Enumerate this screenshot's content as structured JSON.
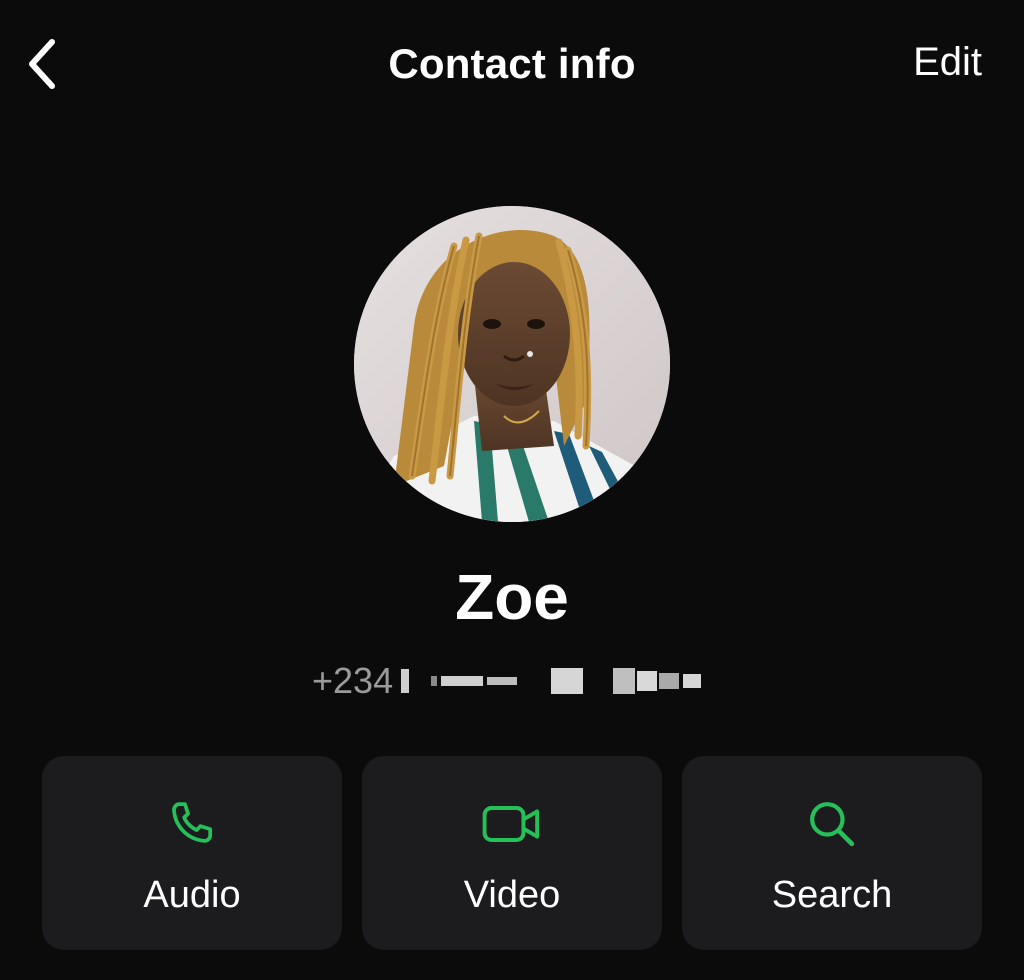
{
  "nav": {
    "title": "Contact info",
    "edit_label": "Edit"
  },
  "contact": {
    "name": "Zoe",
    "phone_prefix": "+234"
  },
  "actions": [
    {
      "label": "Audio",
      "icon": "phone-icon"
    },
    {
      "label": "Video",
      "icon": "video-camera-icon"
    },
    {
      "label": "Search",
      "icon": "search-icon"
    }
  ],
  "colors": {
    "background": "#0b0b0b",
    "card": "#1c1c1e",
    "accent_green": "#25c05a",
    "secondary_text": "#9a9a9a"
  }
}
